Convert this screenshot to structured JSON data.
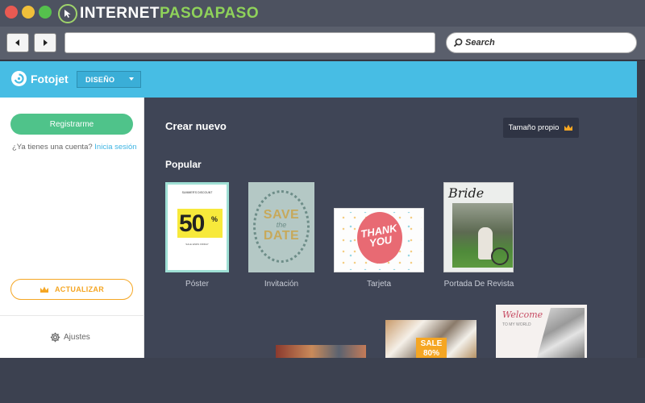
{
  "site": {
    "brand_part1": "INTERNET",
    "brand_part2": "PASOAPASO"
  },
  "browser": {
    "search_placeholder": "Search"
  },
  "app": {
    "logo_text": "Fotojet",
    "design_select": "DISEÑO"
  },
  "sidebar": {
    "register_label": "Registrarme",
    "have_account": "¿Ya tienes una cuenta?",
    "login_link": "Inicia sesión",
    "upgrade_label": "ACTUALIZAR",
    "settings_label": "Ajustes"
  },
  "main": {
    "create_new": "Crear nuevo",
    "custom_size": "Tamaño propio",
    "popular": "Popular",
    "templates": [
      {
        "label": "Póster",
        "thumb": {
          "header": "SUMMER'S DISCOUNT",
          "big": "50",
          "suffix": "%",
          "footer": "SALE ENDS FRIDAY"
        }
      },
      {
        "label": "Invitación",
        "thumb": {
          "line1": "SAVE",
          "line2": "the",
          "line3": "DATE"
        }
      },
      {
        "label": "Tarjeta",
        "thumb": {
          "text": "THANK YOU"
        }
      },
      {
        "label": "Portada De Revista",
        "thumb": {
          "title": "Bride"
        }
      }
    ],
    "more": [
      {
        "text": ""
      },
      {
        "text": "SALE 80%"
      },
      {
        "text": "Welcome",
        "subtext": "TO MY WORLD"
      }
    ]
  },
  "colors": {
    "accent": "#47bde4",
    "register": "#4fc38a",
    "upgrade": "#f5a623",
    "main_bg": "#3f4556"
  }
}
